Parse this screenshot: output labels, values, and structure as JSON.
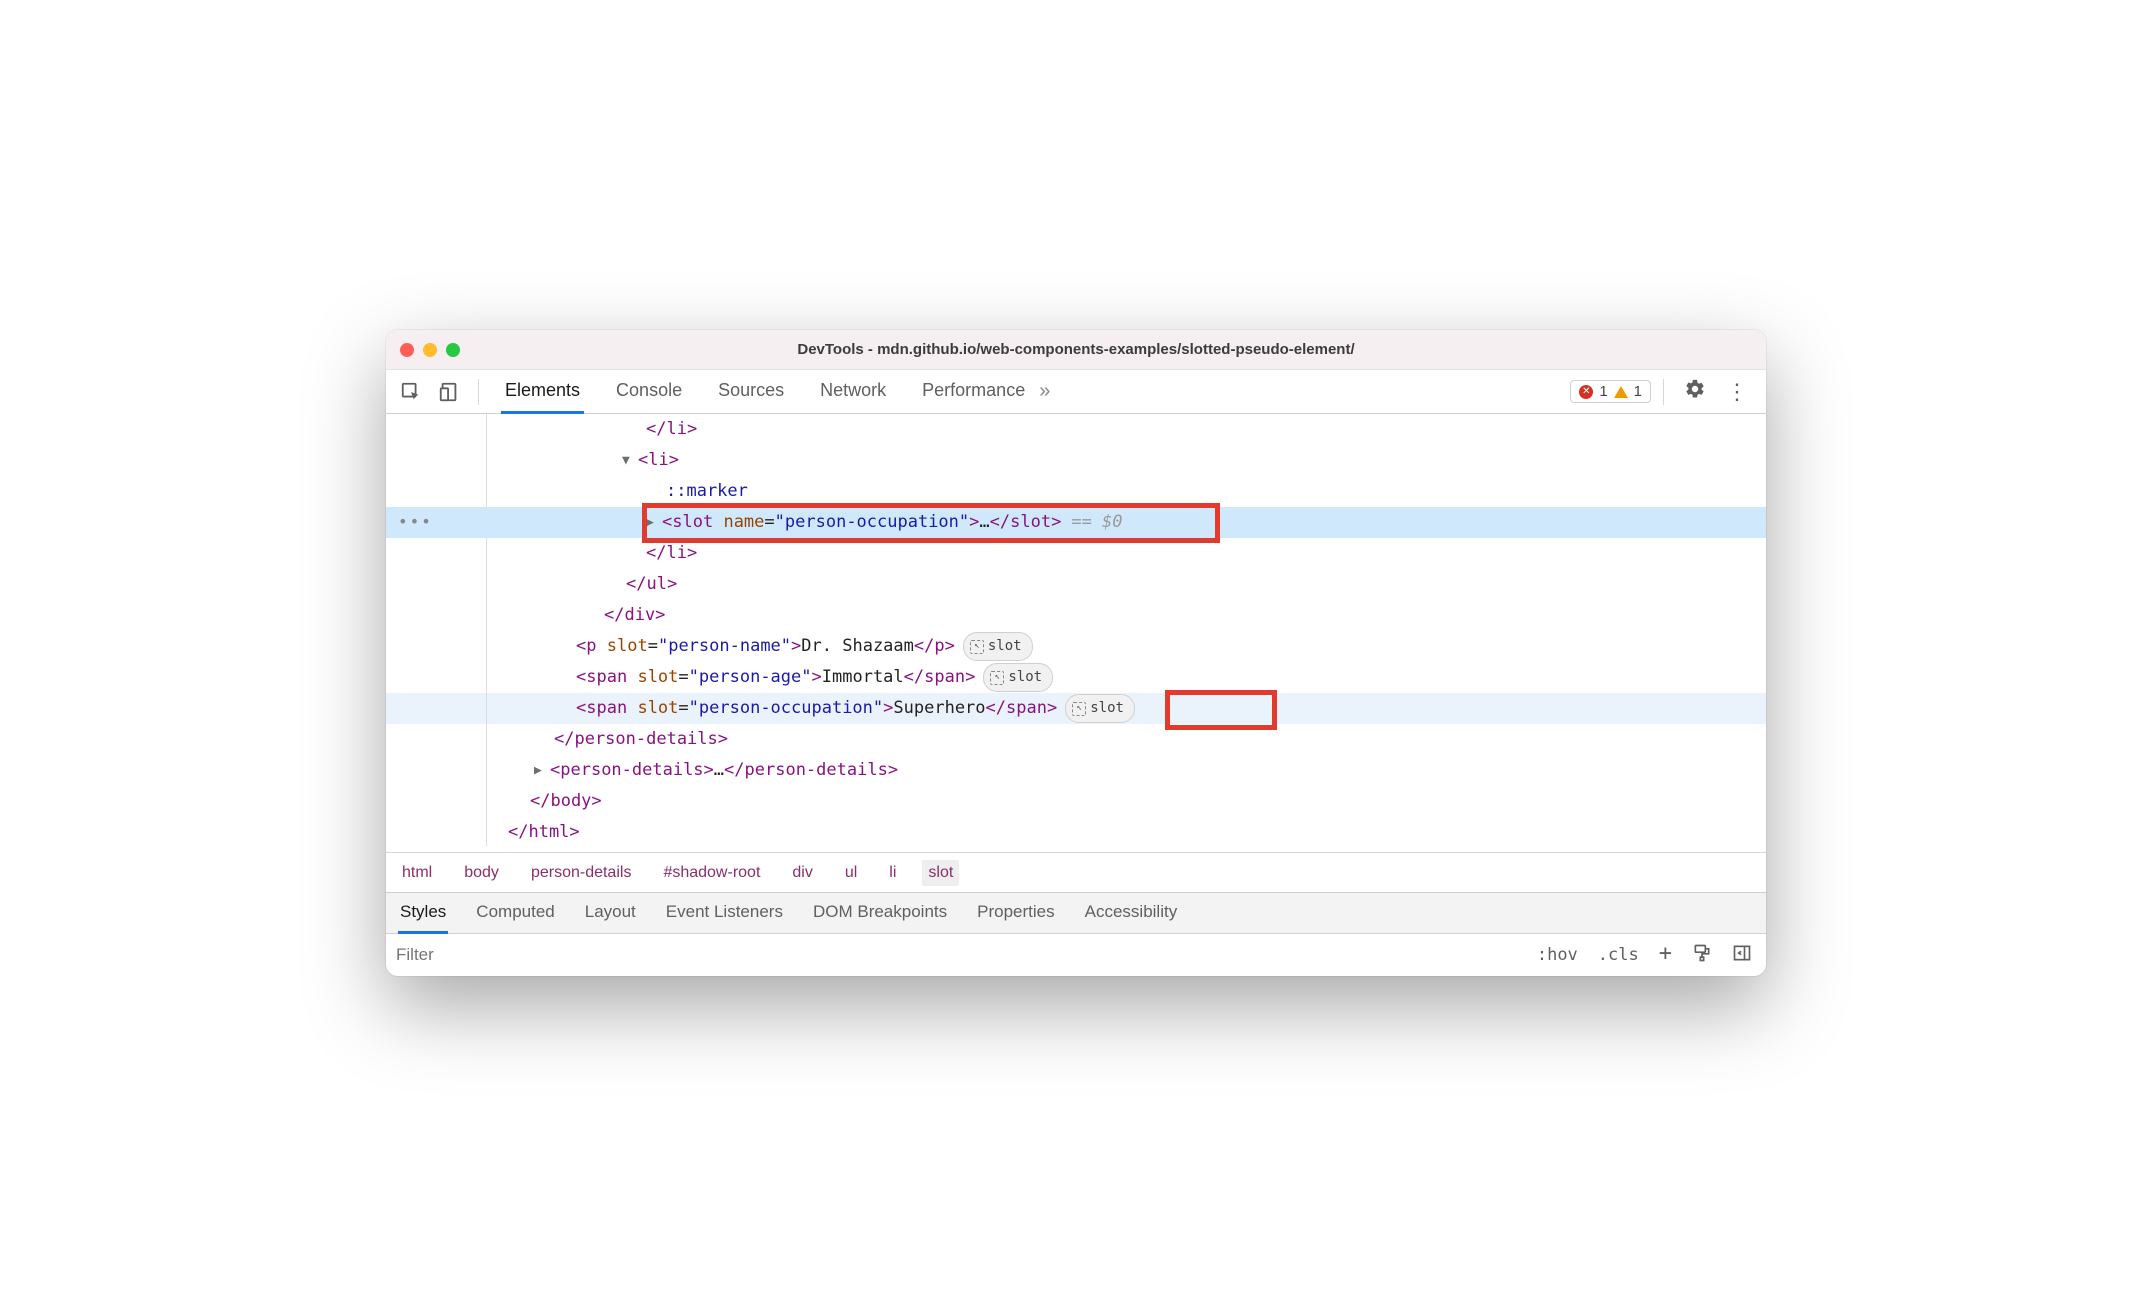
{
  "window": {
    "title": "DevTools - mdn.github.io/web-components-examples/slotted-pseudo-element/"
  },
  "tabs": {
    "elements": "Elements",
    "console": "Console",
    "sources": "Sources",
    "network": "Network",
    "performance": "Performance"
  },
  "issues": {
    "errors": "1",
    "warnings": "1"
  },
  "dom": {
    "li_close1": "</li>",
    "li_open": "<li>",
    "marker": "::marker",
    "slot_open_tag": "slot",
    "slot_attr_name": "name",
    "slot_attr_val": "person-occupation",
    "slot_ellipsis": "…",
    "slot_close_tag": "/slot",
    "eq_dollar": " == $0",
    "li_close2": "</li>",
    "ul_close": "</ul>",
    "div_close": "</div>",
    "p_tag": "p",
    "p_slot_attr": "slot",
    "p_slot_val": "person-name",
    "p_text": "Dr. Shazaam",
    "p_close": "/p",
    "span1_tag": "span",
    "span1_slot_val": "person-age",
    "span1_text": "Immortal",
    "span1_close": "/span",
    "span2_tag": "span",
    "span2_slot_val": "person-occupation",
    "span2_text": "Superhero",
    "span2_close": "/span",
    "pd_close": "</person-details>",
    "pd2_open": "person-details",
    "pd2_ellipsis": "…",
    "pd2_close": "/person-details",
    "body_close": "</body>",
    "html_close": "</html>",
    "slot_badge": "slot"
  },
  "crumbs": {
    "c0": "html",
    "c1": "body",
    "c2": "person-details",
    "c3": "#shadow-root",
    "c4": "div",
    "c5": "ul",
    "c6": "li",
    "c7": "slot"
  },
  "bottom_tabs": {
    "styles": "Styles",
    "computed": "Computed",
    "layout": "Layout",
    "event": "Event Listeners",
    "dom_bp": "DOM Breakpoints",
    "props": "Properties",
    "a11y": "Accessibility"
  },
  "filter": {
    "placeholder": "Filter",
    "hov": ":hov",
    "cls": ".cls",
    "plus": "+"
  }
}
